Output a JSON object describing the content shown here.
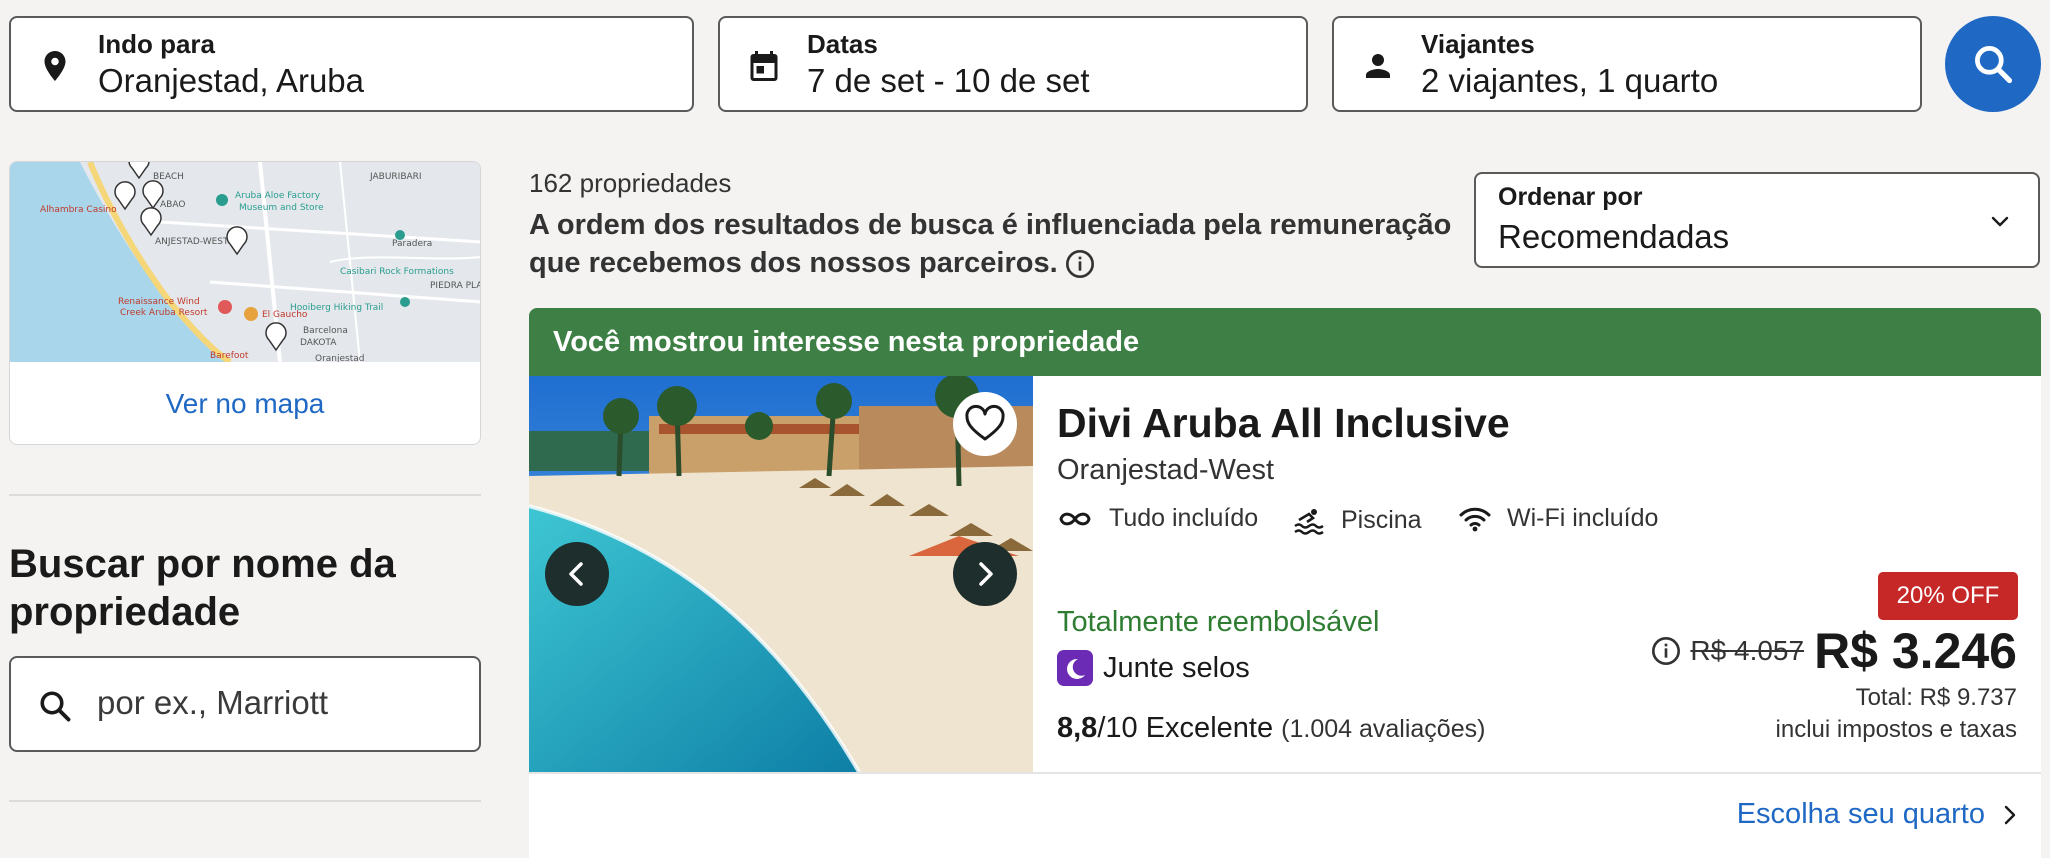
{
  "search": {
    "destination": {
      "label": "Indo para",
      "value": "Oranjestad, Aruba"
    },
    "dates": {
      "label": "Datas",
      "value": "7 de set - 10 de set"
    },
    "travelers": {
      "label": "Viajantes",
      "value": "2 viajantes, 1 quarto"
    }
  },
  "map": {
    "link": "Ver no mapa",
    "labels": [
      "BEACH",
      "JABURIBARI",
      "Alhambra Casino",
      "ABAO",
      "Aruba Aloe Factory",
      "Museum and Store",
      "ANJESTAD-WEST",
      "Paradera",
      "Casibari Rock Formations",
      "PIEDRA PLAT",
      "Renaissance Wind",
      "Creek Aruba Resort",
      "El Gaucho",
      "Hooiberg Hiking Trail",
      "Barcelona",
      "DAKOTA",
      "Barefoot",
      "Oranjestad"
    ]
  },
  "name_search": {
    "title": "Buscar por nome da propriedade",
    "placeholder": "por ex., Marriott"
  },
  "results": {
    "count": "162 propriedades",
    "disclaimer": "A ordem dos resultados de busca é influenciada pela remuneração que recebemos dos nossos parceiros."
  },
  "sort": {
    "label": "Ordenar por",
    "value": "Recomendadas"
  },
  "property": {
    "banner": "Você mostrou interesse nesta propriedade",
    "name": "Divi Aruba All Inclusive",
    "location": "Oranjestad-West",
    "amenities": [
      "Tudo incluído",
      "Piscina",
      "Wi-Fi incluído"
    ],
    "refund": "Totalmente reembolsável",
    "stamps": "Junte selos",
    "rating_score": "8,8",
    "rating_scale": "/10",
    "rating_label": "Excelente",
    "reviews": "(1.004 avaliações)",
    "discount": "20% OFF",
    "old_price": "R$ 4.057",
    "price": "R$ 3.246",
    "total": "Total: R$ 9.737",
    "taxes": "inclui impostos e taxas",
    "choose_room": "Escolha seu quarto"
  },
  "colors": {
    "primary": "#1f69c4",
    "banner": "#3d7f45",
    "refund": "#2e7d32",
    "discount": "#c62828",
    "stamps": "#6c2bb5"
  }
}
